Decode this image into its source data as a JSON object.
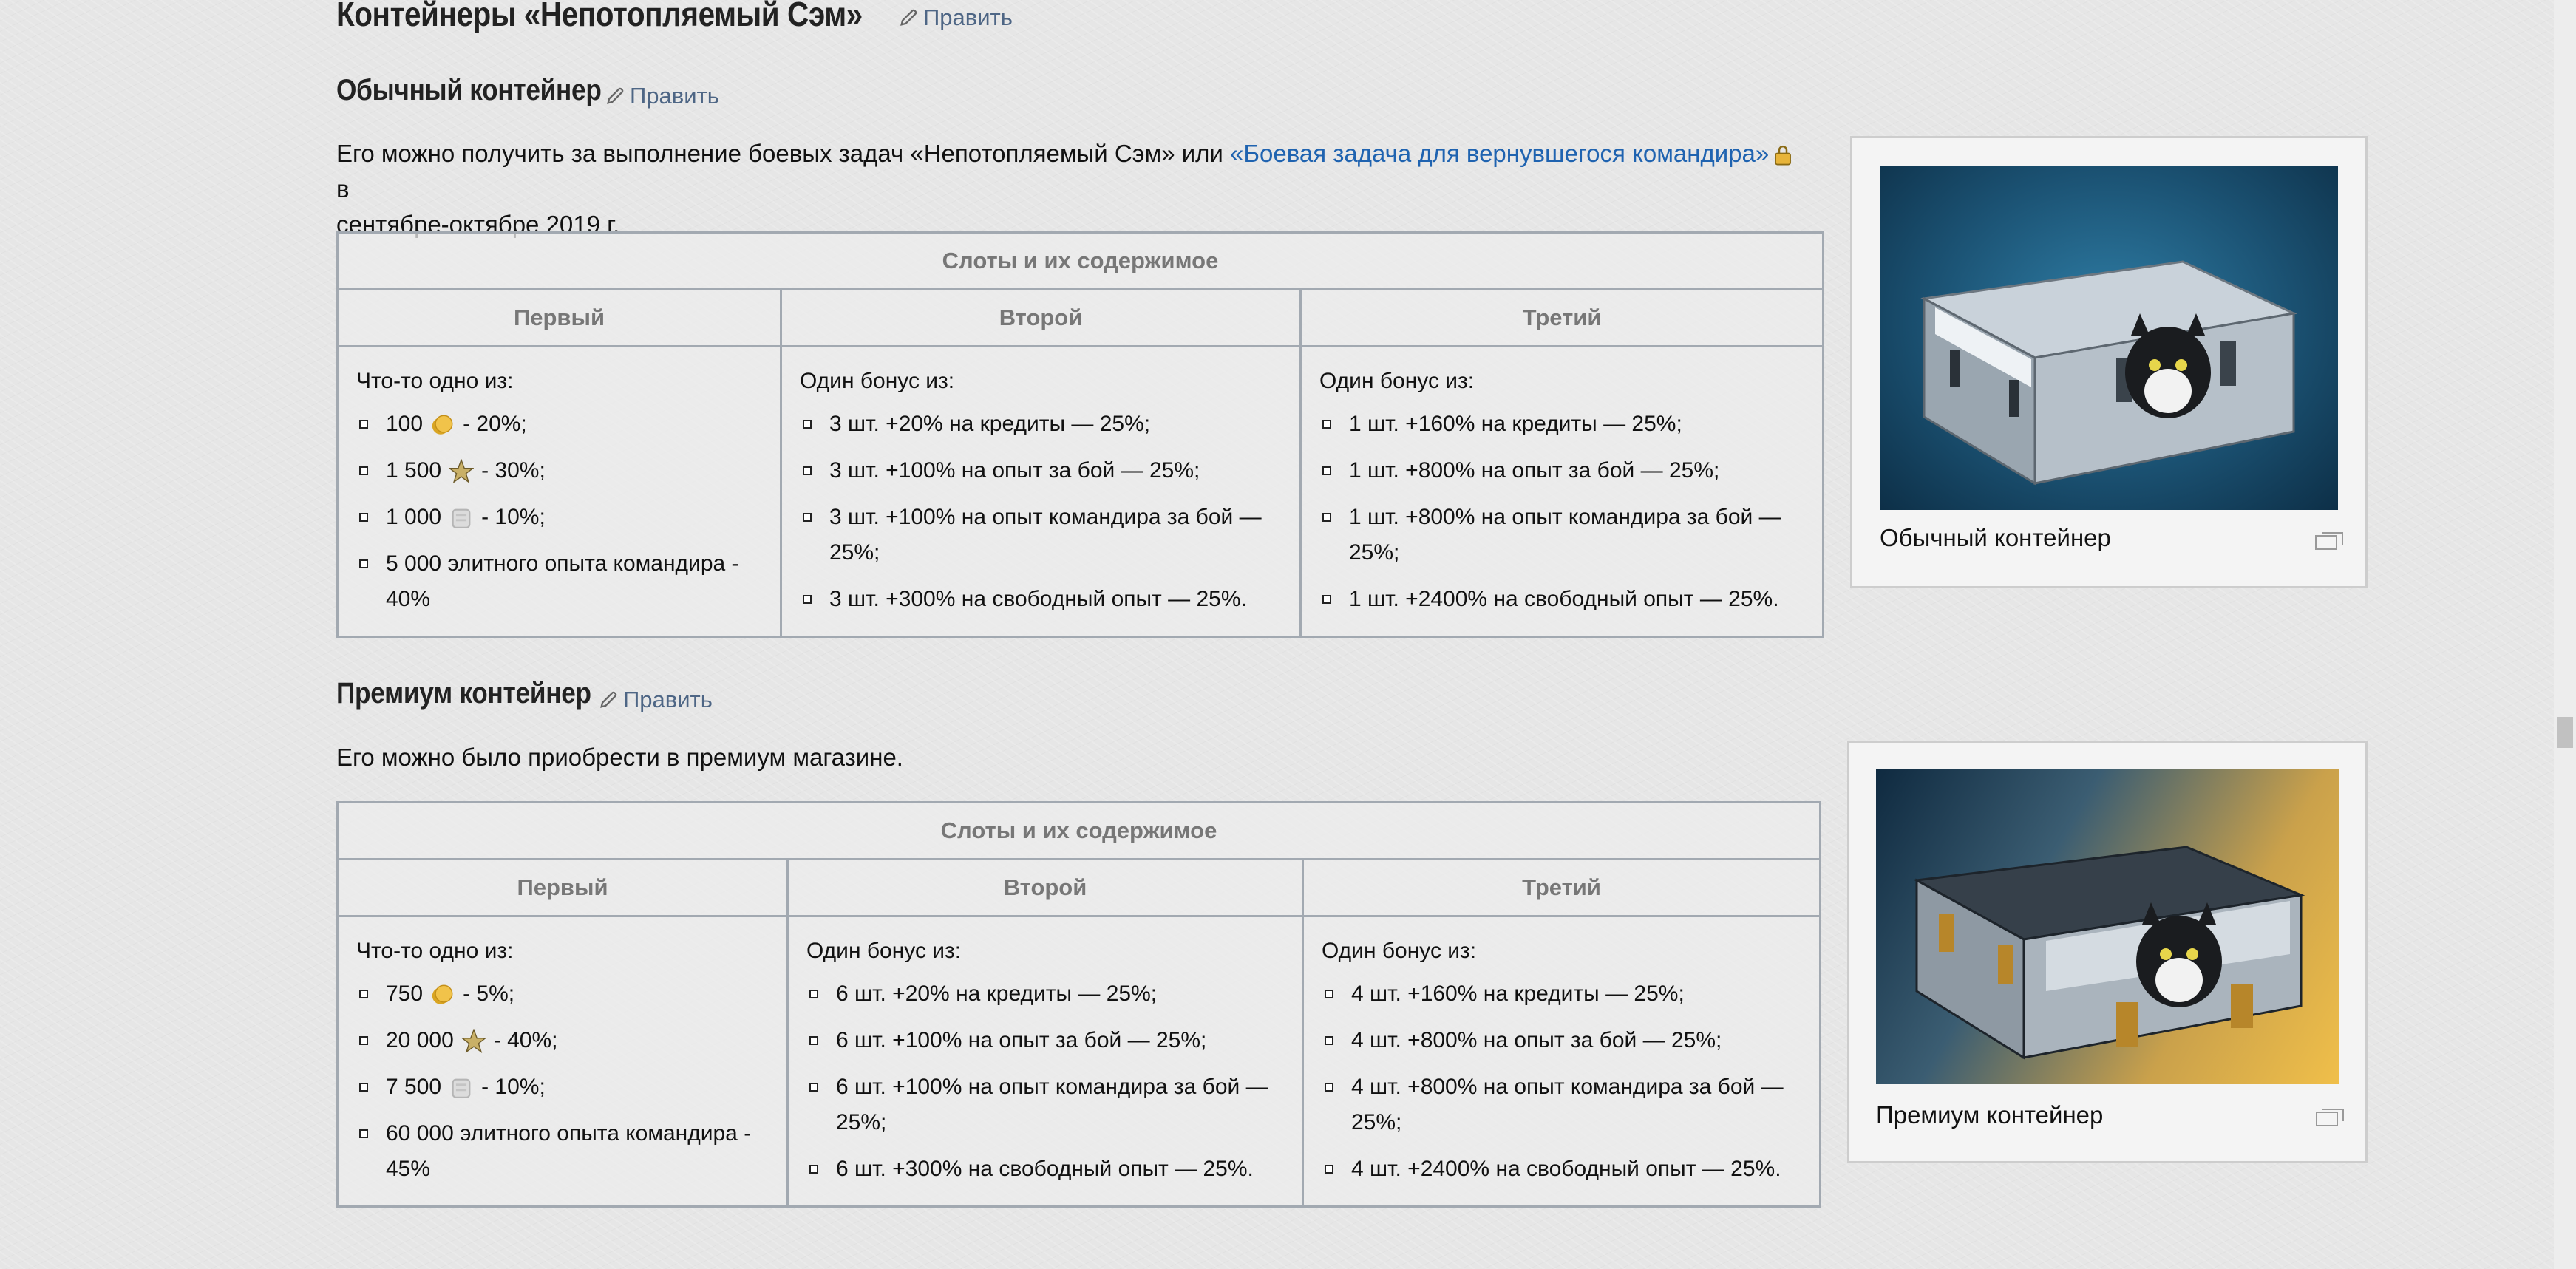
{
  "page": {
    "title": "Контейнеры «Непотопляемый Сэм»",
    "edit_label": "Править"
  },
  "regular": {
    "heading": "Обычный контейнер",
    "edit_label": "Править",
    "intro_text": "Его можно получить за выполнение боевых задач «Непотопляемый Сэм» или ",
    "intro_link": "«Боевая задача для вернувшегося командира»",
    "intro_after_link": " в",
    "intro_line2": "сентябре-октябре 2019 г.",
    "table": {
      "caption": "Слоты и их содержимое",
      "columns": [
        "Первый",
        "Второй",
        "Третий"
      ],
      "first_title": "Что-то одно из:",
      "first_items": [
        {
          "amount": "100",
          "icon": "gold-icon",
          "suffix": "- 20%;"
        },
        {
          "amount": "1 500",
          "icon": "free-xp-star-icon",
          "suffix": "- 30%;"
        },
        {
          "amount": "1 000",
          "icon": "bond-icon",
          "suffix": "- 10%;"
        },
        {
          "text": "5 000 элитного опыта командира - 40%"
        }
      ],
      "second_title": "Один бонус из:",
      "second_items": [
        "3 шт. +20% на кредиты — 25%;",
        "3 шт. +100% на опыт за бой — 25%;",
        "3 шт. +100% на опыт командира за бой — 25%;",
        "3 шт. +300% на свободный опыт — 25%."
      ],
      "third_title": "Один бонус из:",
      "third_items": [
        "1 шт. +160% на кредиты — 25%;",
        "1 шт. +800% на опыт за бой — 25%;",
        "1 шт. +800% на опыт командира за бой — 25%;",
        "1 шт. +2400% на свободный опыт — 25%."
      ]
    },
    "image_caption": "Обычный контейнер"
  },
  "premium": {
    "heading": "Премиум контейнер",
    "edit_label": "Править",
    "intro_text": "Его можно было приобрести в премиум магазине.",
    "table": {
      "caption": "Слоты и их содержимое",
      "columns": [
        "Первый",
        "Второй",
        "Третий"
      ],
      "first_title": "Что-то одно из:",
      "first_items": [
        {
          "amount": "750",
          "icon": "gold-icon",
          "suffix": "- 5%;"
        },
        {
          "amount": "20 000",
          "icon": "free-xp-star-icon",
          "suffix": "- 40%;"
        },
        {
          "amount": "7 500",
          "icon": "bond-icon",
          "suffix": "- 10%;"
        },
        {
          "text": "60 000 элитного опыта командира - 45%"
        }
      ],
      "second_title": "Один бонус из:",
      "second_items": [
        "6 шт. +20% на кредиты — 25%;",
        "6 шт. +100% на опыт за бой — 25%;",
        "6 шт. +100% на опыт командира за бой — 25%;",
        "6 шт. +300% на свободный опыт — 25%."
      ],
      "third_title": "Один бонус из:",
      "third_items": [
        "4 шт. +160% на кредиты — 25%;",
        "4 шт. +800% на опыт за бой — 25%;",
        "4 шт. +800% на опыт командира за бой — 25%;",
        "4 шт. +2400% на свободный опыт — 25%."
      ]
    },
    "image_caption": "Премиум контейнер"
  },
  "colors": {
    "link": "#1f63b0",
    "edit_link": "#4e6685",
    "table_border": "#a2a9b1",
    "header_text": "#777777"
  }
}
